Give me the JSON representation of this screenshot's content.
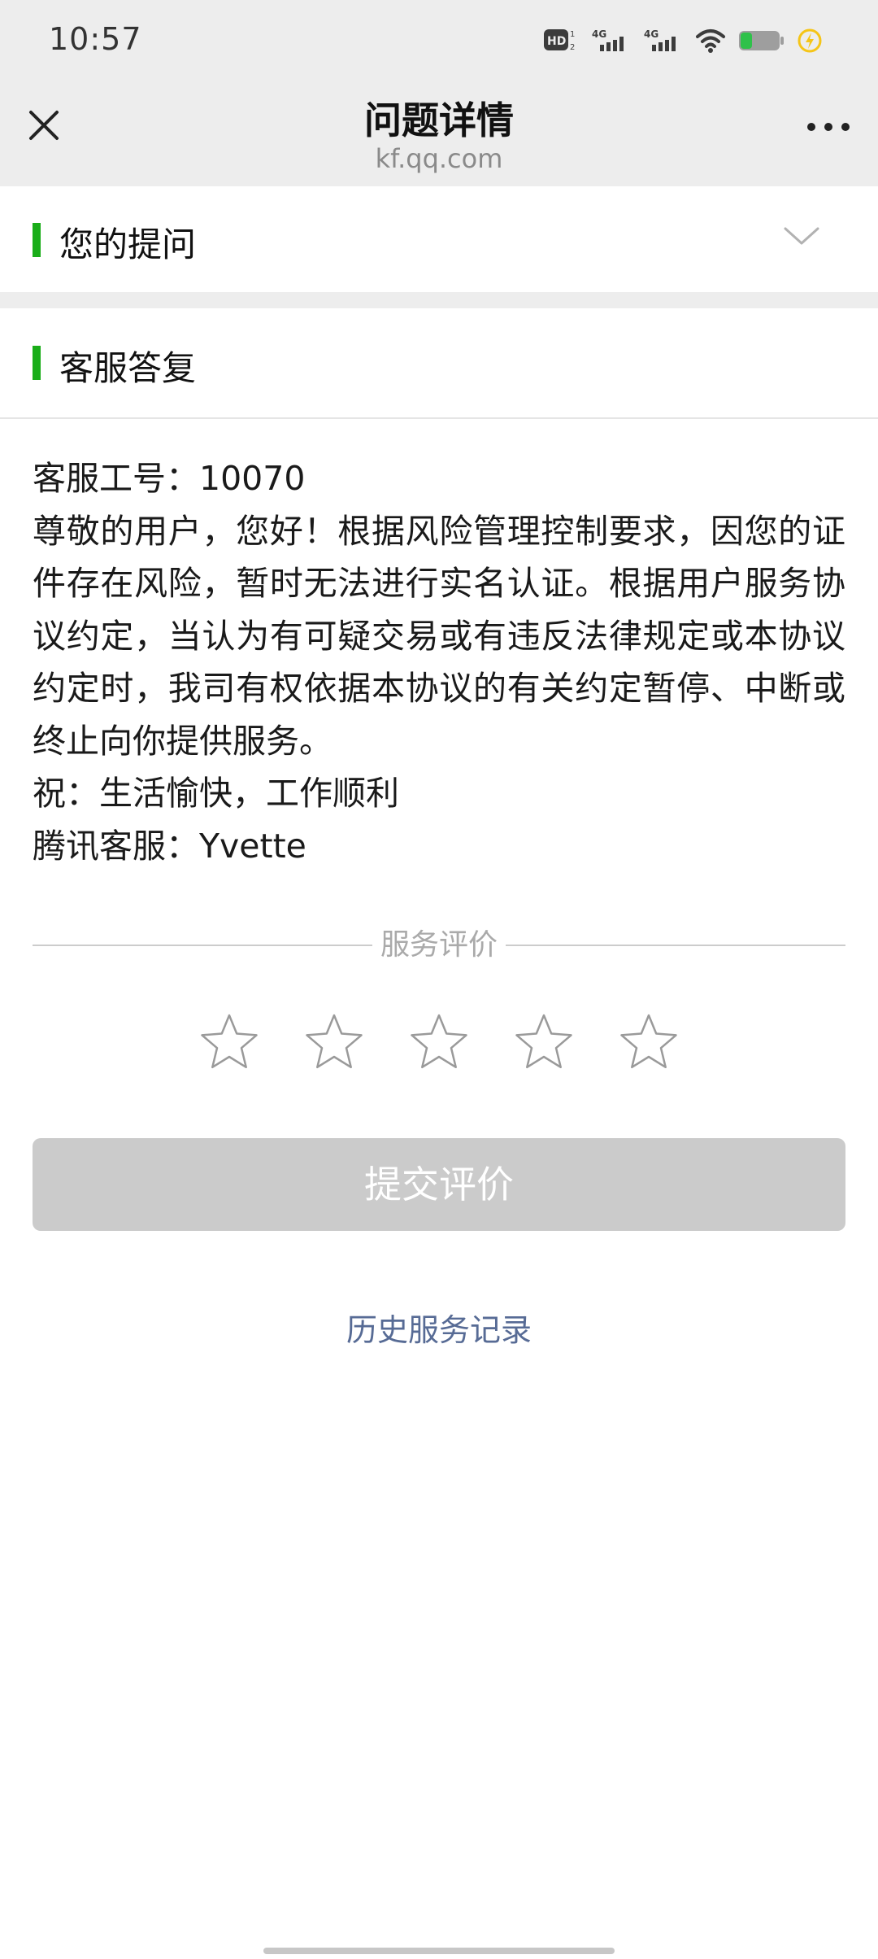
{
  "status_bar": {
    "time": "10:57",
    "icons": [
      "hd-icon",
      "signal-4g-icon",
      "signal-4g-icon",
      "wifi-icon",
      "battery-icon",
      "charging-icon"
    ]
  },
  "nav": {
    "title": "问题详情",
    "subtitle": "kf.qq.com"
  },
  "question_section": {
    "title": "您的提问"
  },
  "reply_section": {
    "title": "客服答复",
    "lines": [
      "客服工号：10070",
      "尊敬的用户，您好！根据风险管理控制要求，因您的证件存在风险，暂时无法进行实名认证。根据用户服务协议约定，当认为有可疑交易或有违反法律规定或本协议约定时，我司有权依据本协议的有关约定暂停、中断或终止向你提供服务。",
      "祝：生活愉快，工作顺利",
      "腾讯客服：Yvette"
    ]
  },
  "rating": {
    "label": "服务评价",
    "max_stars": 5,
    "selected": 0
  },
  "submit_button": {
    "label": "提交评价"
  },
  "history_link": {
    "label": "历史服务记录"
  },
  "colors": {
    "accent_green": "#1aad19",
    "link_blue": "#576b95",
    "button_disabled": "#cbcbcb"
  }
}
